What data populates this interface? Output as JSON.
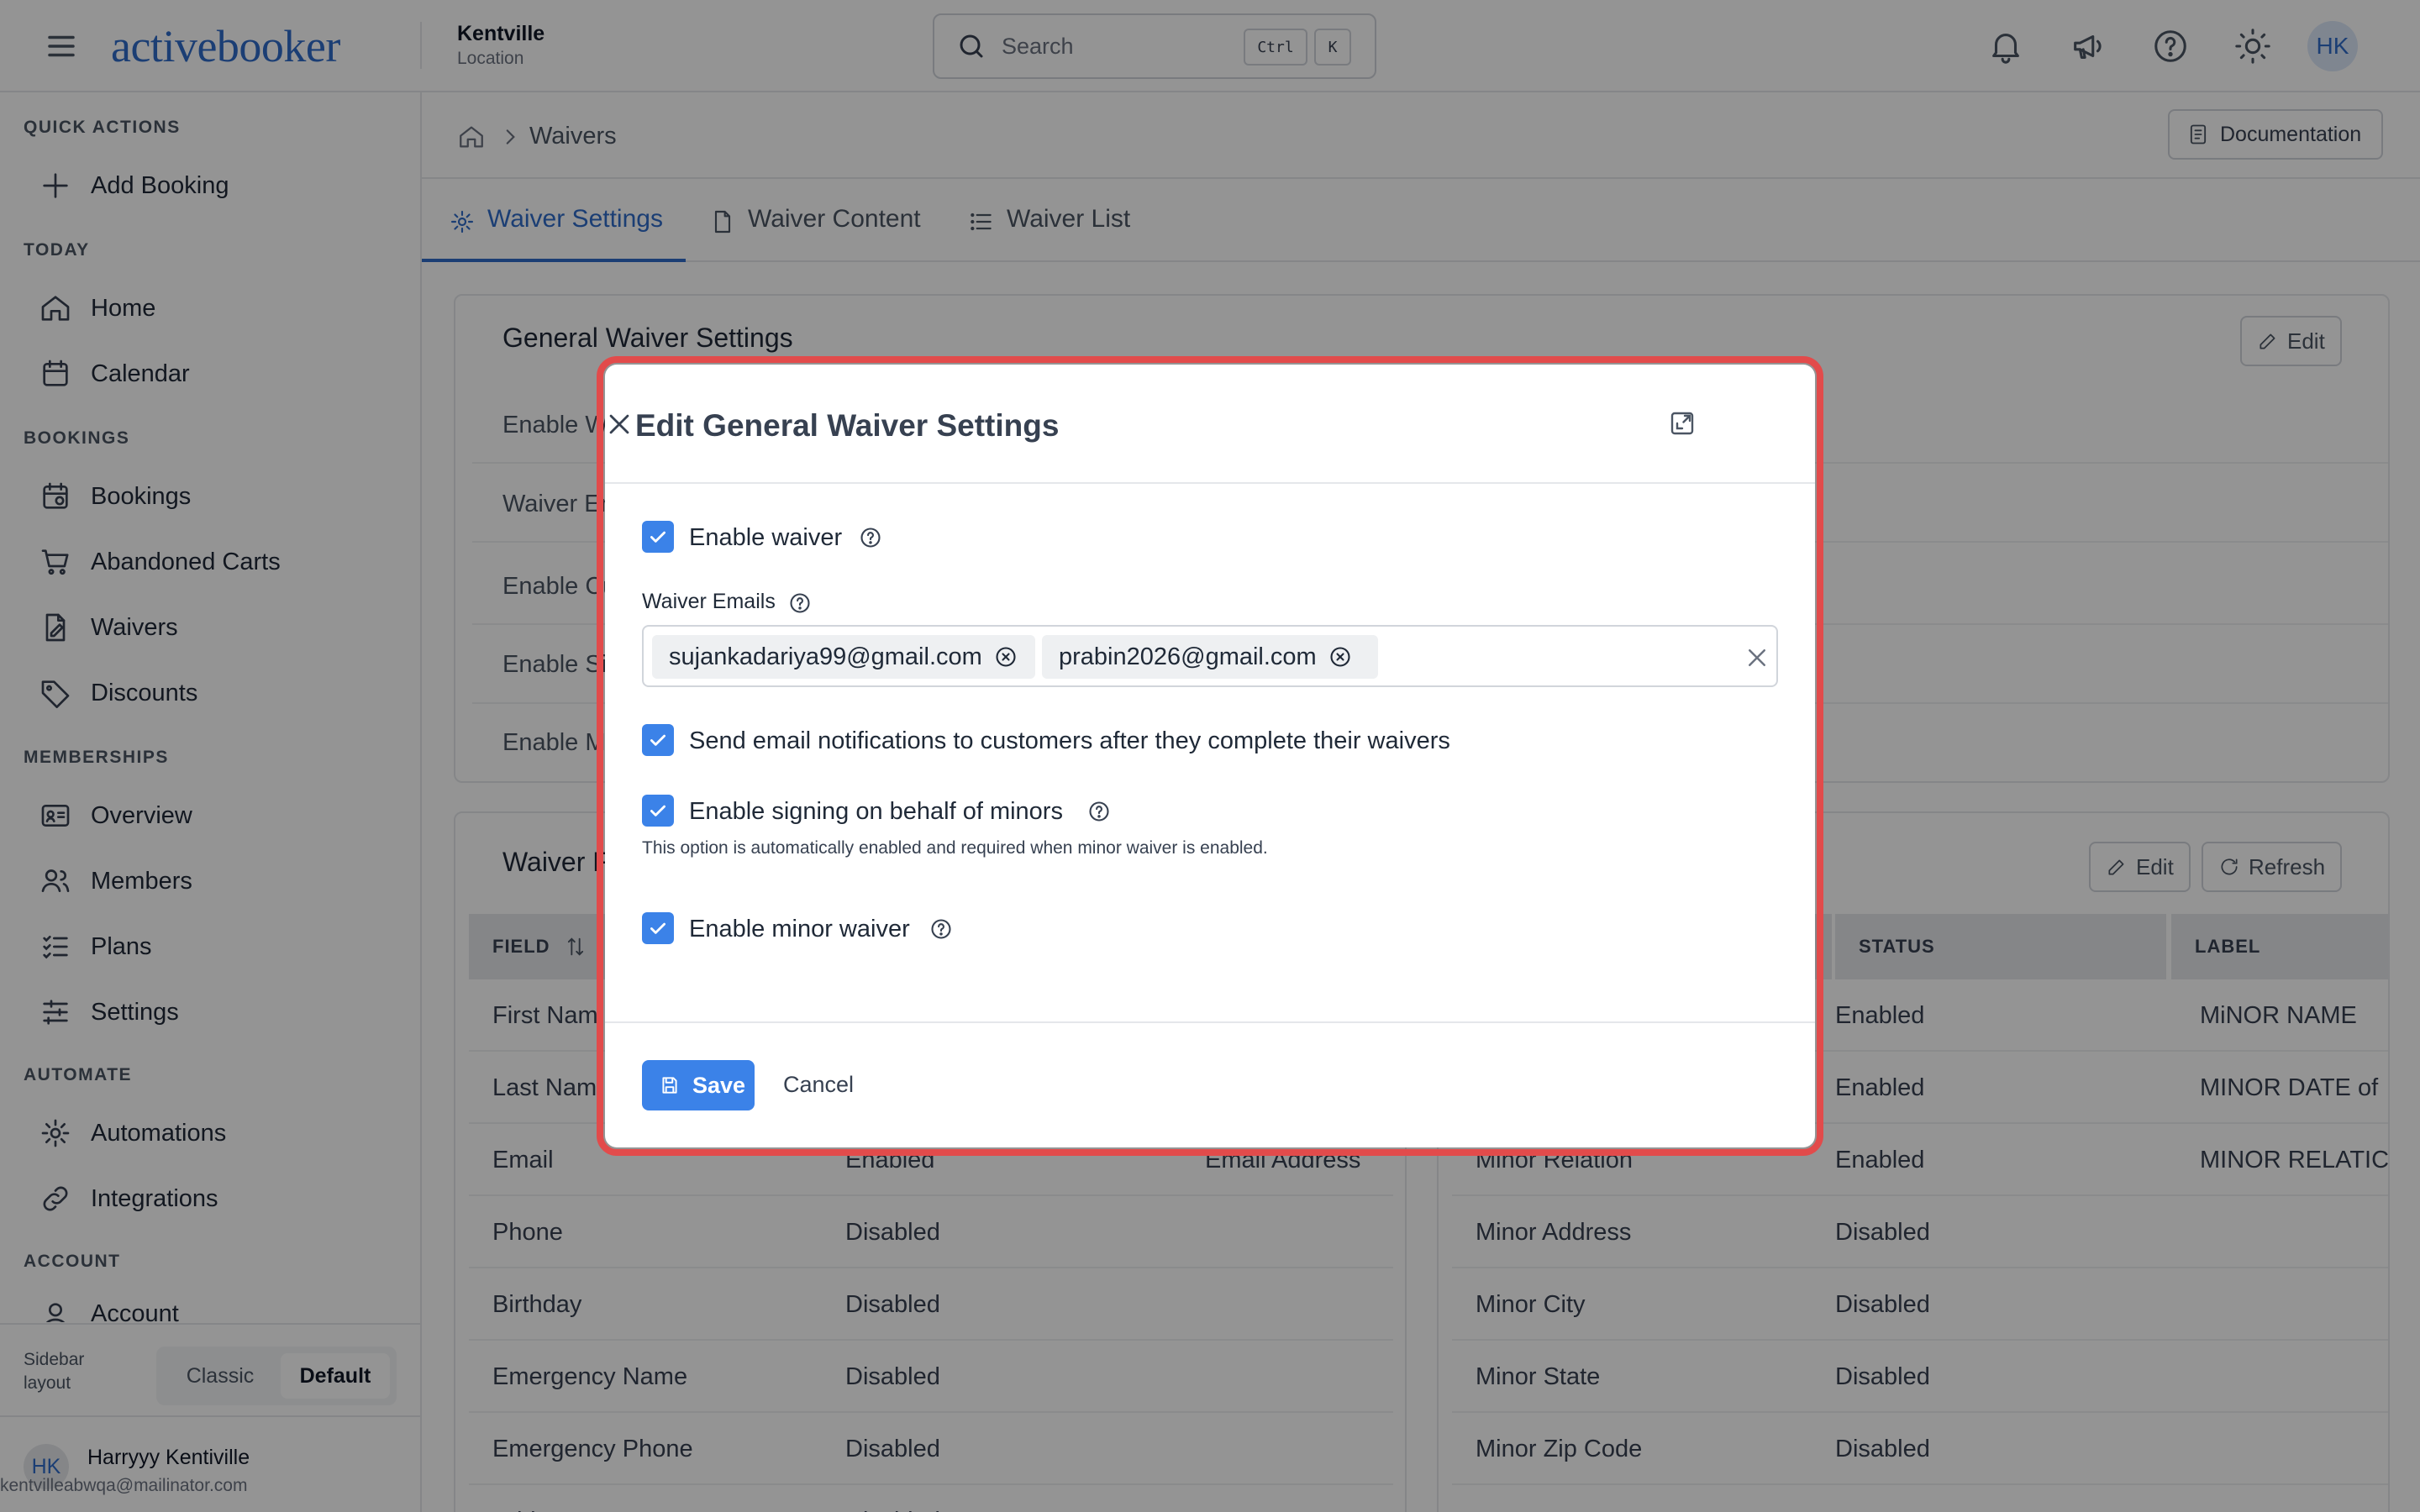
{
  "header": {
    "logo_text": "activebooker",
    "location_name": "Kentville",
    "location_sub": "Location",
    "search_placeholder": "Search",
    "shortcut_ctrl": "Ctrl",
    "shortcut_key": "K",
    "avatar_initials": "HK"
  },
  "sidebar": {
    "sections": {
      "quick_actions": "QUICK ACTIONS",
      "today": "TODAY",
      "bookings": "BOOKINGS",
      "memberships": "MEMBERSHIPS",
      "automate": "AUTOMATE",
      "account": "ACCOUNT"
    },
    "items": {
      "add_booking": "Add Booking",
      "home": "Home",
      "calendar": "Calendar",
      "bookings": "Bookings",
      "abandoned_carts": "Abandoned Carts",
      "waivers": "Waivers",
      "discounts": "Discounts",
      "overview": "Overview",
      "members": "Members",
      "plans": "Plans",
      "settings": "Settings",
      "automations": "Automations",
      "integrations": "Integrations",
      "account": "Account"
    },
    "layout_label_1": "Sidebar",
    "layout_label_2": "layout",
    "layout_options": [
      "Classic",
      "Default"
    ],
    "user": {
      "initials": "HK",
      "name": "Harryyy Kentiville",
      "email": "kentvilleabwqa@mailinator.com"
    }
  },
  "main": {
    "breadcrumb": "Waivers",
    "documentation_label": "Documentation",
    "tabs": [
      "Waiver Settings",
      "Waiver Content",
      "Waiver List"
    ],
    "general_card": {
      "title": "General Waiver Settings",
      "edit_label": "Edit",
      "rows": [
        "Enable Wa",
        "Waiver Em",
        "Enable Cu",
        "Enable Si",
        "Enable M"
      ]
    },
    "fields_card": {
      "title": "Waiver Fo",
      "edit_label": "Edit",
      "refresh_label": "Refresh",
      "left_header": "FIELD",
      "left_rows": [
        {
          "field": "First Nam",
          "status": "",
          "label": ""
        },
        {
          "field": "Last Nam",
          "status": "",
          "label": ""
        },
        {
          "field": "Email",
          "status": "Enabled",
          "label": "Email Address"
        },
        {
          "field": "Phone",
          "status": "Disabled",
          "label": ""
        },
        {
          "field": "Birthday",
          "status": "Disabled",
          "label": ""
        },
        {
          "field": "Emergency Name",
          "status": "Disabled",
          "label": ""
        },
        {
          "field": "Emergency Phone",
          "status": "Disabled",
          "label": ""
        },
        {
          "field": "Address",
          "status": "Disabled",
          "label": ""
        }
      ],
      "right_headers": [
        "STATUS",
        "LABEL"
      ],
      "right_rows": [
        {
          "field": "",
          "status": "Enabled",
          "label": "MiNOR NAME"
        },
        {
          "field": "",
          "status": "Enabled",
          "label": "MINOR DATE of"
        },
        {
          "field": "Minor Relation",
          "status": "Enabled",
          "label": "MINOR RELATIC"
        },
        {
          "field": "Minor Address",
          "status": "Disabled",
          "label": ""
        },
        {
          "field": "Minor City",
          "status": "Disabled",
          "label": ""
        },
        {
          "field": "Minor State",
          "status": "Disabled",
          "label": ""
        },
        {
          "field": "Minor Zip Code",
          "status": "Disabled",
          "label": ""
        }
      ]
    }
  },
  "modal": {
    "title": "Edit General Waiver Settings",
    "enable_waiver": {
      "label": "Enable waiver",
      "checked": true
    },
    "waiver_emails_label": "Waiver Emails",
    "emails": [
      "sujankadariya99@gmail.com",
      "prabin2026@gmail.com"
    ],
    "send_notifications": {
      "label": "Send email notifications to customers after they complete their waivers",
      "checked": true
    },
    "enable_minors_signing": {
      "label": "Enable signing on behalf of minors",
      "checked": true
    },
    "minors_hint": "This option is automatically enabled and required when minor waiver is enabled.",
    "enable_minor_waiver": {
      "label": "Enable minor waiver",
      "checked": true
    },
    "save_label": "Save",
    "cancel_label": "Cancel",
    "accent_color": "#3b82e8",
    "highlight_color": "#e24b4b"
  }
}
